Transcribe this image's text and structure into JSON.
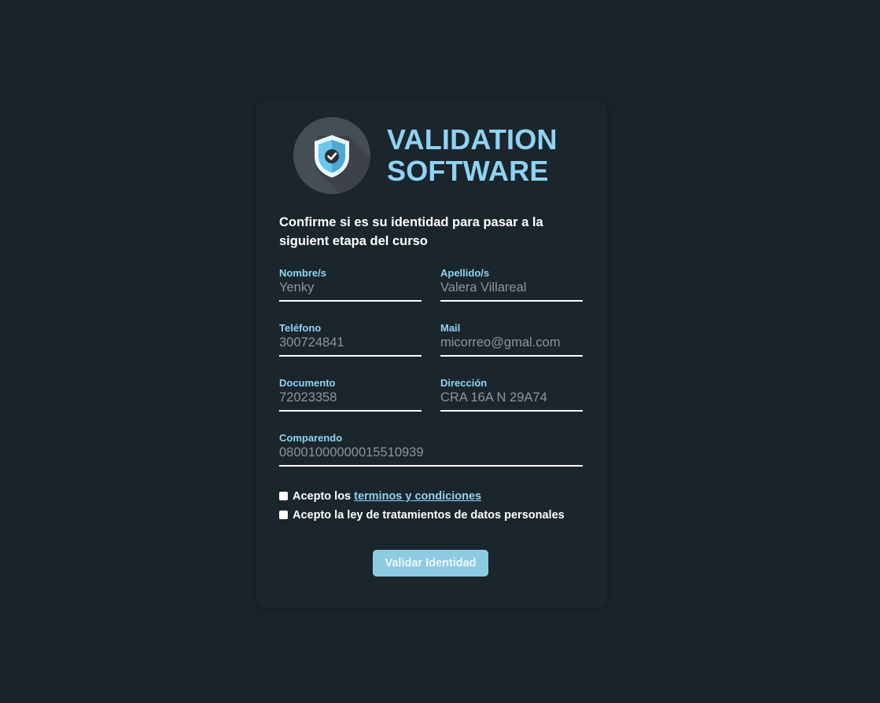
{
  "brand": {
    "line1": "VALIDATION",
    "line2": "SOFTWARE",
    "logo_icon": "shield-check-icon",
    "accent_color": "#8fd3f4"
  },
  "intro": "Confirme si es su identidad para pasar a la siguient etapa del curso",
  "fields": {
    "nombre": {
      "label": "Nombre/s",
      "value": "Yenky"
    },
    "apellido": {
      "label": "Apellido/s",
      "value": "Valera Villareal"
    },
    "telefono": {
      "label": "Teléfono",
      "value": "300724841"
    },
    "mail": {
      "label": "Mail",
      "value": "micorreo@gmal.com"
    },
    "documento": {
      "label": "Documento",
      "value": "72023358"
    },
    "direccion": {
      "label": "Dirección",
      "value": "CRA 16A N 29A74"
    },
    "comparendo": {
      "label": "Comparendo",
      "value": "08001000000015510939"
    }
  },
  "checks": {
    "terms_prefix": "Acepto los",
    "terms_link": "terminos y condiciones",
    "data_law": "Acepto la ley de tratamientos de datos personales"
  },
  "submit_label": "Validar Identidad"
}
